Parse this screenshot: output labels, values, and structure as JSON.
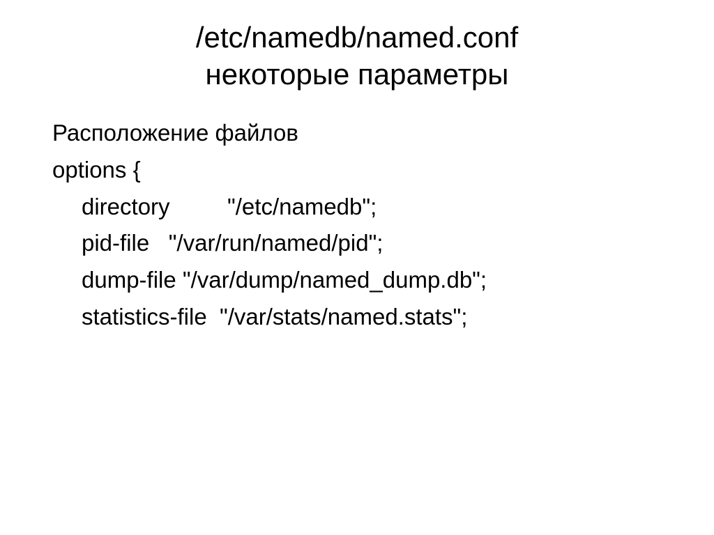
{
  "title": {
    "line1": "/etc/namedb/named.conf",
    "line2": "некоторые параметры"
  },
  "body": {
    "line1": "Расположение файлов",
    "line2": "options {",
    "line3": "directory         \"/etc/namedb\";",
    "line4": "pid-file   \"/var/run/named/pid\";",
    "line5": "dump-file \"/var/dump/named_dump.db\";",
    "line6": "statistics-file  \"/var/stats/named.stats\";"
  }
}
